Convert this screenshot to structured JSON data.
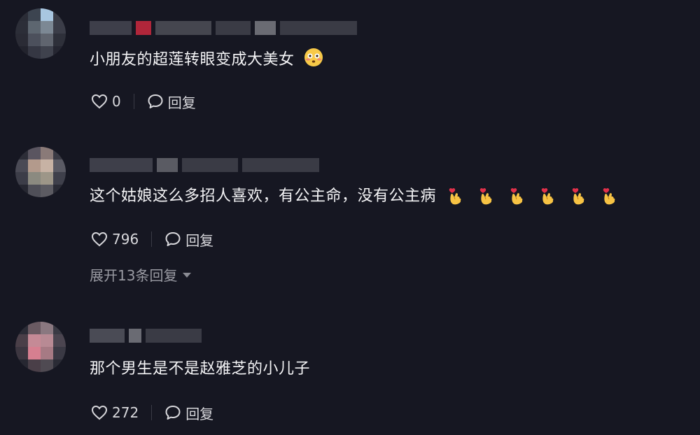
{
  "comments": [
    {
      "text": "小朋友的超莲转眼变成大美女",
      "emoji": "flushed-face",
      "likes": "0",
      "reply_label": "回复"
    },
    {
      "text": "这个姑娘这么多招人喜欢，有公主命，没有公主病",
      "emoji": "finger-heart",
      "emoji_count": 6,
      "likes": "796",
      "reply_label": "回复",
      "expand_label": "展开13条回复"
    },
    {
      "text": "那个男生是不是赵雅芝的小儿子",
      "likes": "272",
      "reply_label": "回复"
    }
  ],
  "colors": {
    "background": "#161722",
    "text": "#f4f4f6",
    "secondary": "#9a9ba3"
  }
}
